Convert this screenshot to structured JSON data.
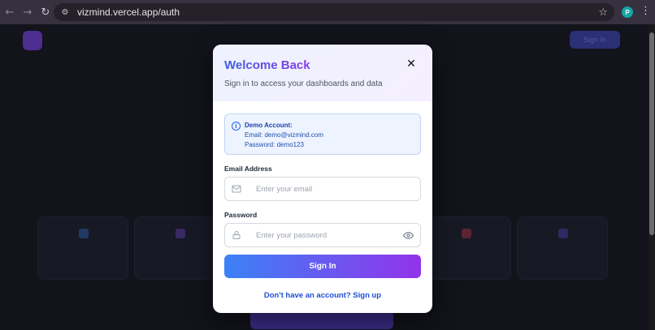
{
  "browser": {
    "url": "vizmind.vercel.app/auth",
    "profile_initial": "P"
  },
  "background": {
    "signin_label": "Sign In"
  },
  "modal": {
    "title": "Welcome Back",
    "subtitle": "Sign in to access your dashboards and data",
    "close_label": "✕",
    "demo": {
      "title": "Demo Account:",
      "email_line": "Email: demo@vizmind.com",
      "password_line": "Password: demo123"
    },
    "email": {
      "label": "Email Address",
      "placeholder": "Enter your email"
    },
    "password": {
      "label": "Password",
      "placeholder": "Enter your password"
    },
    "submit_label": "Sign In",
    "signup_link": "Don't have an account? Sign up"
  },
  "colors": {
    "accent_start": "#3b82f6",
    "accent_end": "#9333ea",
    "demo_bg": "#eef4ff"
  },
  "icons": [
    "back-icon",
    "forward-icon",
    "reload-icon",
    "site-settings-icon",
    "star-icon",
    "kebab-menu-icon",
    "close-icon",
    "info-icon",
    "mail-icon",
    "lock-icon",
    "eye-icon"
  ]
}
